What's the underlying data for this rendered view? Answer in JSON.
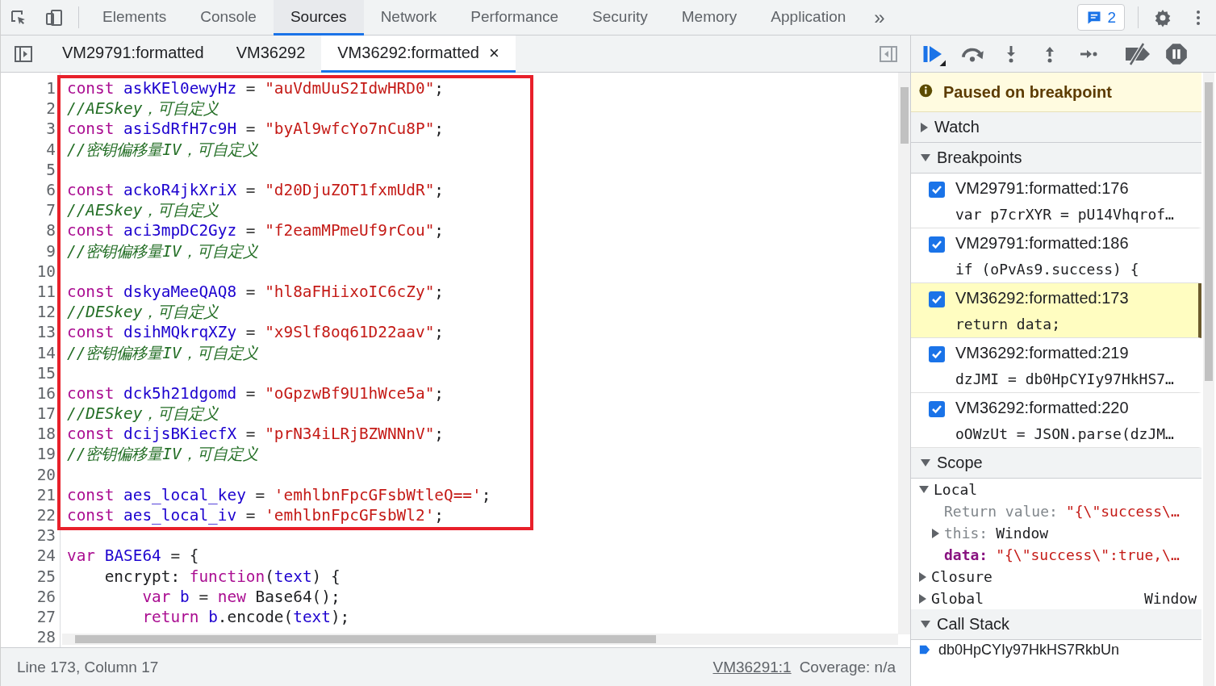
{
  "toolbar": {
    "tabs": [
      {
        "label": "Elements",
        "selected": false
      },
      {
        "label": "Console",
        "selected": false
      },
      {
        "label": "Sources",
        "selected": true
      },
      {
        "label": "Network",
        "selected": false
      },
      {
        "label": "Performance",
        "selected": false
      },
      {
        "label": "Security",
        "selected": false
      },
      {
        "label": "Memory",
        "selected": false
      },
      {
        "label": "Application",
        "selected": false
      }
    ],
    "more": "»",
    "issues_count": "2"
  },
  "file_tabs": [
    {
      "label": "VM29791:formatted",
      "selected": false,
      "closable": false
    },
    {
      "label": "VM36292",
      "selected": false,
      "closable": false
    },
    {
      "label": "VM36292:formatted",
      "selected": true,
      "closable": true
    }
  ],
  "close_mark": "×",
  "editor": {
    "blocks": [
      {
        "boxed": true,
        "lines": [
          {
            "number": "1",
            "tokens": [
              {
                "kind": "keyword",
                "text": "const"
              },
              {
                "kind": "def",
                "text": " askKEl0ewyHz"
              },
              {
                "kind": "op",
                "text": " = "
              },
              {
                "kind": "string",
                "text": "\"auVdmUuS2IdwHRD0\""
              },
              {
                "kind": "plain",
                "text": ";"
              }
            ]
          },
          {
            "number": "2",
            "tokens": [
              {
                "kind": "comment",
                "text": "//AESkey，可自定义"
              }
            ]
          },
          {
            "number": "3",
            "tokens": [
              {
                "kind": "keyword",
                "text": "const"
              },
              {
                "kind": "def",
                "text": " asiSdRfH7c9H"
              },
              {
                "kind": "op",
                "text": " = "
              },
              {
                "kind": "string",
                "text": "\"byAl9wfcYo7nCu8P\""
              },
              {
                "kind": "plain",
                "text": ";"
              }
            ]
          },
          {
            "number": "4",
            "tokens": [
              {
                "kind": "comment",
                "text": "//密钥偏移量IV，可自定义"
              }
            ]
          },
          {
            "number": "5"
          },
          {
            "number": "6",
            "tokens": [
              {
                "kind": "keyword",
                "text": "const"
              },
              {
                "kind": "def",
                "text": " ackoR4jkXriX"
              },
              {
                "kind": "op",
                "text": " = "
              },
              {
                "kind": "string",
                "text": "\"d20DjuZOT1fxmUdR\""
              },
              {
                "kind": "plain",
                "text": ";"
              }
            ]
          },
          {
            "number": "7",
            "tokens": [
              {
                "kind": "comment",
                "text": "//AESkey，可自定义"
              }
            ]
          },
          {
            "number": "8",
            "tokens": [
              {
                "kind": "keyword",
                "text": "const"
              },
              {
                "kind": "def",
                "text": " aci3mpDC2Gyz"
              },
              {
                "kind": "op",
                "text": " = "
              },
              {
                "kind": "string",
                "text": "\"f2eamMPmeUf9rCou\""
              },
              {
                "kind": "plain",
                "text": ";"
              }
            ]
          },
          {
            "number": "9",
            "tokens": [
              {
                "kind": "comment",
                "text": "//密钥偏移量IV，可自定义"
              }
            ]
          },
          {
            "number": "10"
          },
          {
            "number": "11",
            "tokens": [
              {
                "kind": "keyword",
                "text": "const"
              },
              {
                "kind": "def",
                "text": " dskyaMeeQAQ8"
              },
              {
                "kind": "op",
                "text": " = "
              },
              {
                "kind": "string",
                "text": "\"hl8aFHiixoIC6cZy\""
              },
              {
                "kind": "plain",
                "text": ";"
              }
            ]
          },
          {
            "number": "12",
            "tokens": [
              {
                "kind": "comment",
                "text": "//DESkey，可自定义"
              }
            ]
          },
          {
            "number": "13",
            "tokens": [
              {
                "kind": "keyword",
                "text": "const"
              },
              {
                "kind": "def",
                "text": " dsihMQkrqXZy"
              },
              {
                "kind": "op",
                "text": " = "
              },
              {
                "kind": "string",
                "text": "\"x9Slf8oq61D22aav\""
              },
              {
                "kind": "plain",
                "text": ";"
              }
            ]
          },
          {
            "number": "14",
            "tokens": [
              {
                "kind": "comment",
                "text": "//密钥偏移量IV，可自定义"
              }
            ]
          },
          {
            "number": "15"
          },
          {
            "number": "16",
            "tokens": [
              {
                "kind": "keyword",
                "text": "const"
              },
              {
                "kind": "def",
                "text": " dck5h21dgomd"
              },
              {
                "kind": "op",
                "text": " = "
              },
              {
                "kind": "string",
                "text": "\"oGpzwBf9U1hWce5a\""
              },
              {
                "kind": "plain",
                "text": ";"
              }
            ]
          },
          {
            "number": "17",
            "tokens": [
              {
                "kind": "comment",
                "text": "//DESkey，可自定义"
              }
            ]
          },
          {
            "number": "18",
            "tokens": [
              {
                "kind": "keyword",
                "text": "const"
              },
              {
                "kind": "def",
                "text": " dcijsBKiecfX"
              },
              {
                "kind": "op",
                "text": " = "
              },
              {
                "kind": "string",
                "text": "\"prN34iLRjBZWNNnV\""
              },
              {
                "kind": "plain",
                "text": ";"
              }
            ]
          },
          {
            "number": "19",
            "tokens": [
              {
                "kind": "comment",
                "text": "//密钥偏移量IV，可自定义"
              }
            ]
          },
          {
            "number": "20"
          },
          {
            "number": "21",
            "tokens": [
              {
                "kind": "keyword",
                "text": "const"
              },
              {
                "kind": "def",
                "text": " aes_local_key"
              },
              {
                "kind": "op",
                "text": " = "
              },
              {
                "kind": "string",
                "text": "'emhlbnFpcGFsbWtleQ=='"
              },
              {
                "kind": "plain",
                "text": ";"
              }
            ]
          },
          {
            "number": "22",
            "tokens": [
              {
                "kind": "keyword",
                "text": "const"
              },
              {
                "kind": "def",
                "text": " aes_local_iv"
              },
              {
                "kind": "op",
                "text": " = "
              },
              {
                "kind": "string",
                "text": "'emhlbnFpcGFsbWl2'"
              },
              {
                "kind": "plain",
                "text": ";"
              }
            ]
          }
        ]
      },
      {
        "boxed": false,
        "lines": [
          {
            "number": "23"
          },
          {
            "number": "24",
            "tokens": [
              {
                "kind": "keyword",
                "text": "var"
              },
              {
                "kind": "def",
                "text": " BASE64"
              },
              {
                "kind": "op",
                "text": " = "
              },
              {
                "kind": "plain",
                "text": "{"
              }
            ]
          },
          {
            "number": "25",
            "tokens": [
              {
                "kind": "plain",
                "text": "    encrypt: "
              },
              {
                "kind": "keyword",
                "text": "function"
              },
              {
                "kind": "plain",
                "text": "("
              },
              {
                "kind": "def",
                "text": "text"
              },
              {
                "kind": "plain",
                "text": ") {"
              }
            ]
          },
          {
            "number": "26",
            "tokens": [
              {
                "kind": "keyword",
                "text": "        var"
              },
              {
                "kind": "def",
                "text": " b"
              },
              {
                "kind": "op",
                "text": " = "
              },
              {
                "kind": "keyword",
                "text": "new"
              },
              {
                "kind": "plain",
                "text": " Base64();"
              }
            ]
          },
          {
            "number": "27",
            "tokens": [
              {
                "kind": "keyword",
                "text": "        return"
              },
              {
                "kind": "def",
                "text": " b"
              },
              {
                "kind": "plain",
                "text": ".encode("
              },
              {
                "kind": "def",
                "text": "text"
              },
              {
                "kind": "plain",
                "text": ");"
              }
            ]
          },
          {
            "number": "28"
          }
        ]
      }
    ]
  },
  "status_bar": {
    "position": "Line 173, Column 17",
    "source_link": "VM36291:1",
    "coverage": "Coverage: n/a"
  },
  "debugger": {
    "paused_message": "Paused on breakpoint",
    "watch": {
      "title": "Watch",
      "expanded": false
    },
    "breakpoints": {
      "title": "Breakpoints",
      "expanded": true,
      "items": [
        {
          "location": "VM29791:formatted:176",
          "code": "var p7crXYR = pU14Vhqrof…",
          "checked": true,
          "selected": false
        },
        {
          "location": "VM29791:formatted:186",
          "code": "if (oPvAs9.success) {",
          "checked": true,
          "selected": false
        },
        {
          "location": "VM36292:formatted:173",
          "code": "return data;",
          "checked": true,
          "selected": true
        },
        {
          "location": "VM36292:formatted:219",
          "code": "dzJMI = db0HpCYIy97HkHS7…",
          "checked": true,
          "selected": false
        },
        {
          "location": "VM36292:formatted:220",
          "code": "oOWzUt = JSON.parse(dzJM…",
          "checked": true,
          "selected": false
        }
      ]
    },
    "scope": {
      "title": "Scope",
      "expanded": true,
      "groups": [
        {
          "name": "Local",
          "expanded": true,
          "entries": [
            {
              "kind": "return",
              "name": "Return value:",
              "value": "\"{\\\"success\\…",
              "expandable": false
            },
            {
              "kind": "object",
              "name": "this:",
              "value": "Window",
              "expandable": true
            },
            {
              "kind": "variable",
              "name": "data:",
              "value": "\"{\\\"success\\\":true,\\…",
              "expandable": false
            }
          ]
        },
        {
          "name": "Closure",
          "expanded": false
        },
        {
          "name": "Global",
          "expanded": false,
          "value": "Window"
        }
      ]
    },
    "call_stack": {
      "title": "Call Stack",
      "expanded": true,
      "frames": [
        {
          "name": "db0HpCYIy97HkHS7RkbUn",
          "current": true
        }
      ]
    }
  }
}
